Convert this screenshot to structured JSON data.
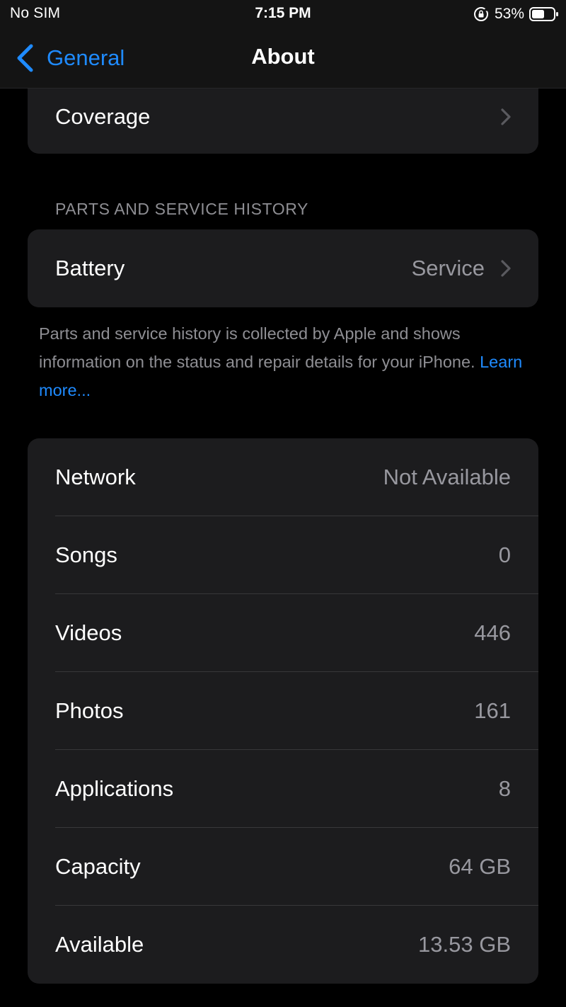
{
  "status_bar": {
    "carrier": "No SIM",
    "time": "7:15 PM",
    "battery_percent": "53%",
    "icons": [
      "orientation-lock-icon",
      "battery-icon"
    ]
  },
  "nav": {
    "back_label": "General",
    "title": "About",
    "back_icon": "chevron-left-icon"
  },
  "coverage_row": {
    "label": "Coverage",
    "icon": "chevron-right-icon"
  },
  "parts_section": {
    "header": "PARTS AND SERVICE HISTORY",
    "battery_row": {
      "label": "Battery",
      "value": "Service",
      "icon": "chevron-right-icon"
    },
    "footer_text": "Parts and service history is collected by Apple and shows information on the status and repair details for your iPhone.",
    "learn_more": "Learn more..."
  },
  "info_rows": [
    {
      "label": "Network",
      "value": "Not Available"
    },
    {
      "label": "Songs",
      "value": "0"
    },
    {
      "label": "Videos",
      "value": "446"
    },
    {
      "label": "Photos",
      "value": "161"
    },
    {
      "label": "Applications",
      "value": "8"
    },
    {
      "label": "Capacity",
      "value": "64 GB"
    },
    {
      "label": "Available",
      "value": "13.53 GB"
    }
  ],
  "colors": {
    "background": "#000000",
    "cell": "#1c1c1e",
    "accent": "#1f8bff",
    "secondary_text": "#98989f"
  }
}
